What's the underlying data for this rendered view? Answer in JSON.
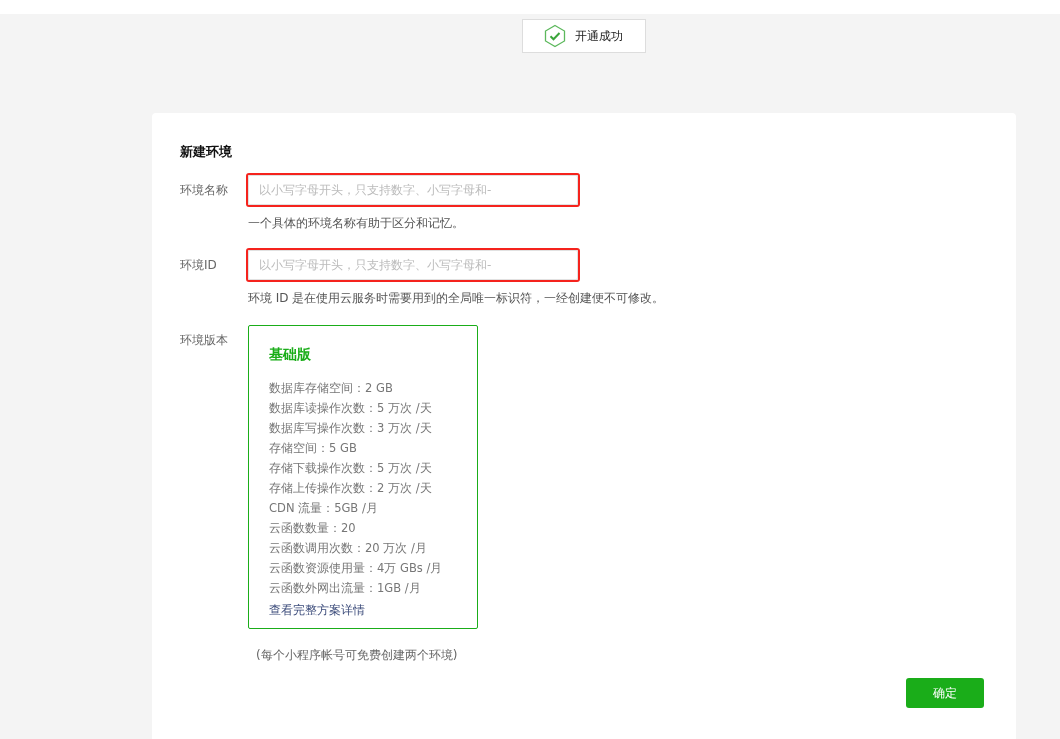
{
  "toast": {
    "text": "开通成功"
  },
  "form": {
    "title": "新建环境",
    "fields": [
      {
        "label": "环境名称",
        "placeholder": "以小写字母开头，只支持数字、小写字母和-",
        "hint": "一个具体的环境名称有助于区分和记忆。",
        "highlighted": true
      },
      {
        "label": "环境ID",
        "placeholder": "以小写字母开头，只支持数字、小写字母和-",
        "hint": "环境 ID 是在使用云服务时需要用到的全局唯一标识符，一经创建便不可修改。",
        "highlighted": true
      }
    ],
    "plan": {
      "label": "环境版本",
      "name": "基础版",
      "selected": true,
      "features": [
        "数据库存储空间：2 GB",
        "数据库读操作次数：5 万次 /天",
        "数据库写操作次数：3 万次 /天",
        "存储空间：5 GB",
        "存储下载操作次数：5 万次 /天",
        "存储上传操作次数：2 万次 /天",
        "CDN 流量：5GB /月",
        "云函数数量：20",
        "云函数调用次数：20 万次 /月",
        "云函数资源使用量：4万 GBs /月",
        "云函数外网出流量：1GB /月"
      ],
      "link": "查看完整方案详情"
    },
    "note": "(每个小程序帐号可免费创建两个环境)",
    "confirm_button": "确定"
  }
}
